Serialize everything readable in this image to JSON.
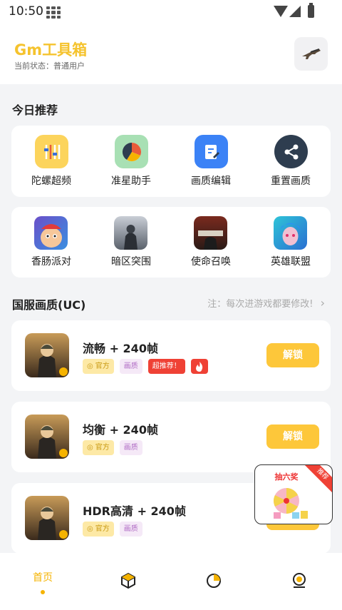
{
  "status_bar": {
    "time": "10:50"
  },
  "header": {
    "title": "Gm工具箱",
    "status": "当前状态：普通用户"
  },
  "sections": {
    "today": "今日推荐",
    "uc": "国服画质(UC)",
    "uc_note": "注：每次进游戏都要修改!"
  },
  "tools": [
    {
      "label": "陀螺超频",
      "icon": "sliders-icon",
      "color": "#fcd45c"
    },
    {
      "label": "准星助手",
      "icon": "pie-chart-icon",
      "color": "#a8e0b4"
    },
    {
      "label": "画质编辑",
      "icon": "edit-document-icon",
      "color": "#3b82f6"
    },
    {
      "label": "重置画质",
      "icon": "share-icon",
      "color": "#2e3d4f"
    }
  ],
  "games": [
    {
      "label": "香肠派对",
      "icon": "sausage-party-icon"
    },
    {
      "label": "暗区突围",
      "icon": "arena-breakout-icon"
    },
    {
      "label": "使命召唤",
      "icon": "call-of-duty-icon"
    },
    {
      "label": "英雄联盟",
      "icon": "league-of-legends-icon"
    }
  ],
  "quality_presets": [
    {
      "title": "流畅 + 240帧",
      "tags": [
        "官方",
        "画质"
      ],
      "hot_tag": "超推荐！",
      "fire": true,
      "button": "解锁"
    },
    {
      "title": "均衡 + 240帧",
      "tags": [
        "官方",
        "画质"
      ],
      "button": "解锁"
    },
    {
      "title": "HDR高清 + 240帧",
      "tags": [
        "官方",
        "画质"
      ],
      "button": "解锁"
    }
  ],
  "lottery": {
    "title": "抽六奖",
    "badge": "推荐"
  },
  "bottom_nav": {
    "home": "首页"
  },
  "colors": {
    "accent": "#f5c32e",
    "button": "#fdc73a",
    "hot": "#ef4135"
  }
}
